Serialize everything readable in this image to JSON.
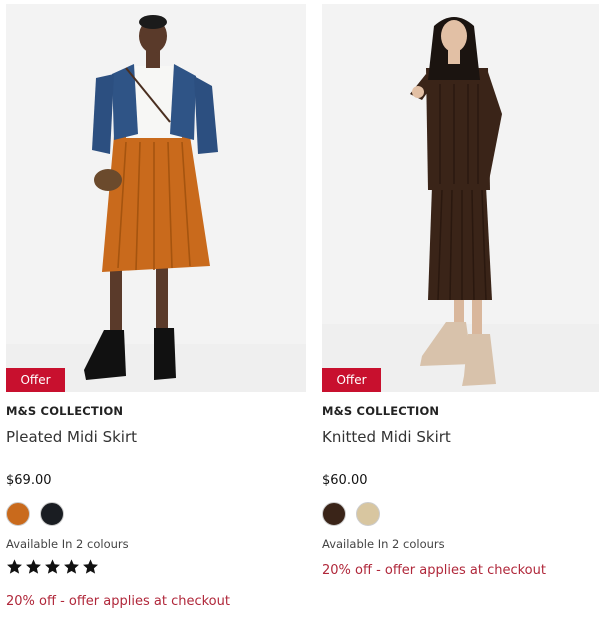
{
  "products": [
    {
      "badge": "Offer",
      "brand": "M&S COLLECTION",
      "name": "Pleated Midi Skirt",
      "price": "$69.00",
      "colours": [
        "#c96a1c",
        "#1a1d22"
      ],
      "availability": "Available In 2 colours",
      "rating": 5,
      "promo": "20% off - offer applies at checkout"
    },
    {
      "badge": "Offer",
      "brand": "M&S COLLECTION",
      "name": "Knitted Midi Skirt",
      "price": "$60.00",
      "colours": [
        "#3a2418",
        "#d8c6a0"
      ],
      "availability": "Available In 2 colours",
      "promo": "20% off - offer applies at checkout"
    }
  ],
  "colors": {
    "badge_bg": "#c8102e",
    "promo_text": "#b0273a"
  }
}
